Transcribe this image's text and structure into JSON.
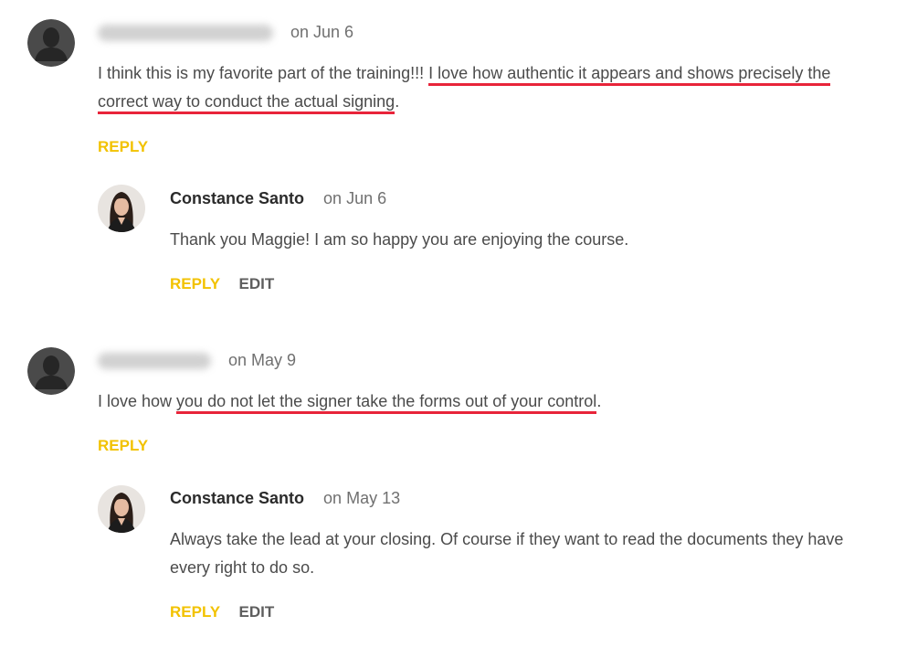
{
  "comments": [
    {
      "author": "",
      "date": "on Jun 6",
      "text_plain": "I think this is my favorite part of the training!!! ",
      "text_highlight_1": "I love how authentic it appears and shows precisely the",
      "text_highlight_2": "correct way to conduct the actual signing",
      "text_end": ".",
      "reply_label": "REPLY",
      "reply": {
        "author": "Constance Santo",
        "date": "on Jun 6",
        "text": "Thank you Maggie! I am so happy you are enjoying the course.",
        "reply_label": "REPLY",
        "edit_label": "EDIT"
      }
    },
    {
      "author": "",
      "date": "on May 9",
      "text_plain": "I love how ",
      "text_highlight_1": "you do not let the signer take the forms out of your control",
      "text_end": ".",
      "reply_label": "REPLY",
      "reply": {
        "author": "Constance Santo",
        "date": "on May 13",
        "text": "Always take the lead at your closing. Of course if they want to read the documents they have every right to do so.",
        "reply_label": "REPLY",
        "edit_label": "EDIT"
      }
    }
  ],
  "colors": {
    "reply": "#f2c200",
    "highlight_underline": "#e8243a",
    "author": "#2b2b2b"
  },
  "icons": {
    "default_avatar": "person-silhouette-icon",
    "author_avatar": "author-photo"
  }
}
